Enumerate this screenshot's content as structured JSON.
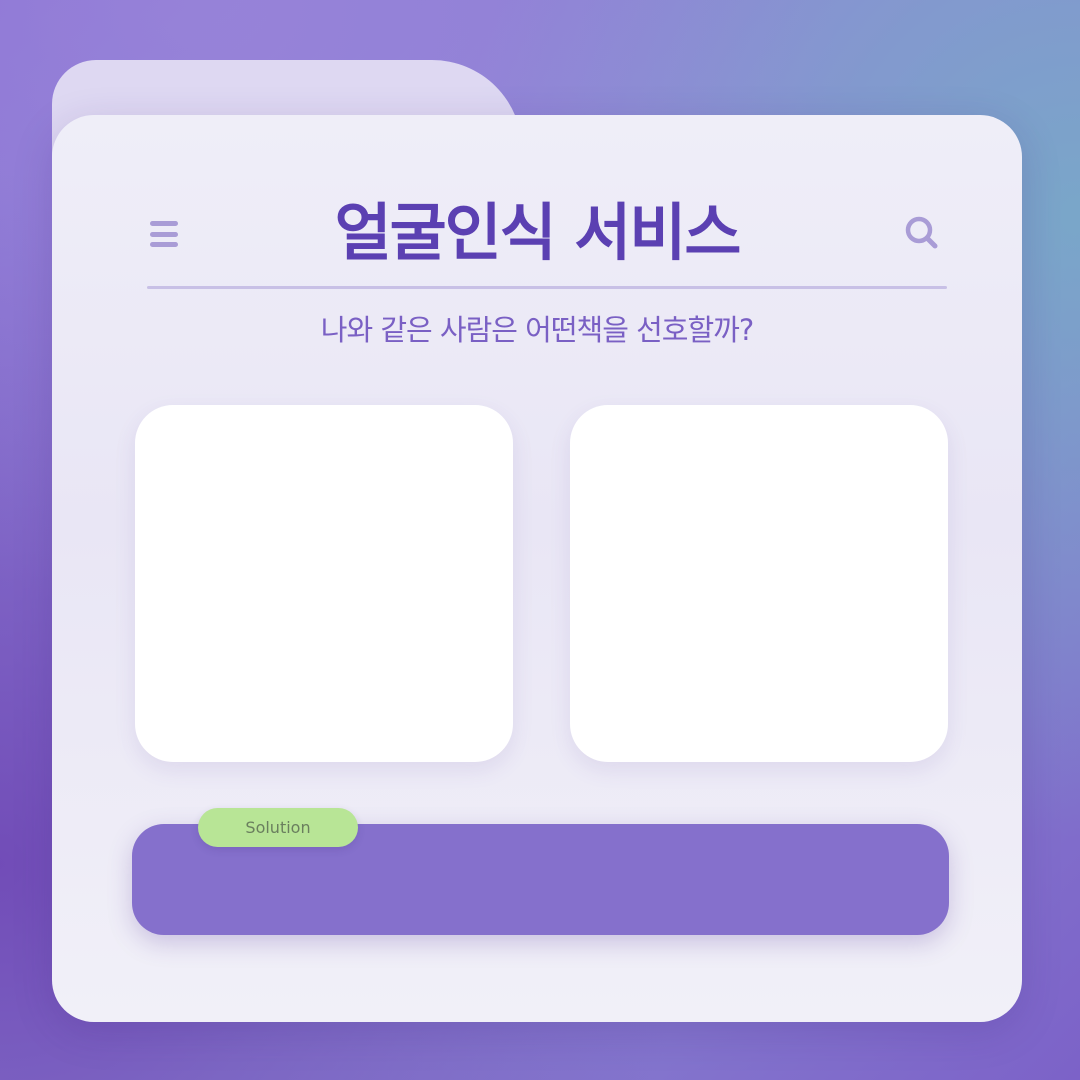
{
  "header": {
    "title": "얼굴인식 서비스",
    "menu_icon": "hamburger-menu-icon",
    "search_icon": "search-icon"
  },
  "subtitle": "나와 같은 사람은 어떤책을 선호할까?",
  "photos": {
    "left_empty": true,
    "right_empty": true
  },
  "result": {
    "badge_label": "Solution",
    "text": ""
  },
  "colors": {
    "accent": "#5b40b2",
    "subtitle": "#7a60c4",
    "result_bar": "#8570cc",
    "badge": "#b8e596",
    "icon": "#a99cd6"
  }
}
